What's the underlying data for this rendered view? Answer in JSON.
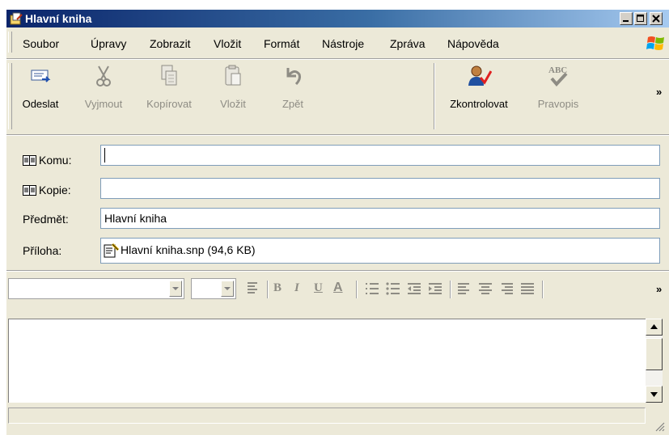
{
  "window": {
    "title": "Hlavní kniha"
  },
  "menu": [
    "Soubor",
    "Úpravy",
    "Zobrazit",
    "Vložit",
    "Formát",
    "Nástroje",
    "Zpráva",
    "Nápověda"
  ],
  "toolbar": {
    "send": "Odeslat",
    "cut": "Vyjmout",
    "copy": "Kopírovat",
    "paste": "Vložit",
    "undo": "Zpět",
    "check": "Zkontrolovat",
    "spelling": "Pravopis",
    "more": "»"
  },
  "fields": {
    "to_label": "Komu:",
    "to_value": "",
    "cc_label": "Kopie:",
    "cc_value": "",
    "subject_label": "Předmět:",
    "subject_value": "Hlavní kniha",
    "attach_label": "Příloha:",
    "attach_value": "Hlavní kniha.snp (94,6 KB)"
  },
  "format": {
    "bold": "B",
    "italic": "I",
    "underline": "U",
    "color": "A",
    "more": "»",
    "spell_icon_text": "ABC"
  },
  "colors": {
    "title_start": "#0a246a",
    "title_end": "#a6caf0",
    "face": "#ece9d8",
    "check_mark": "#e02020"
  }
}
